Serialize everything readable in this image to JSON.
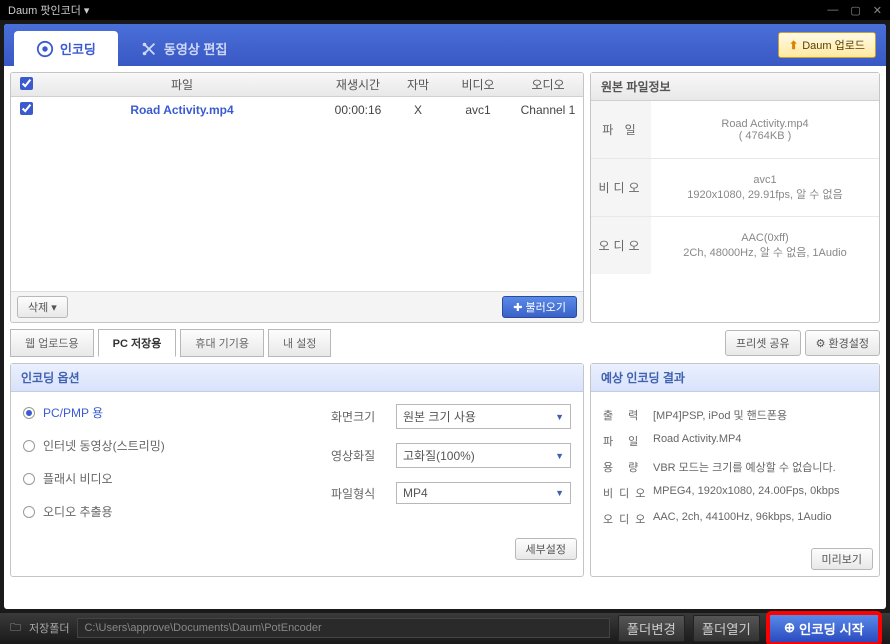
{
  "window": {
    "title": "Daum 팟인코더 ▾"
  },
  "tabs": {
    "encoding": "인코딩",
    "video_edit": "동영상 편집"
  },
  "upload_button": "Daum 업로드",
  "file_table": {
    "headers": {
      "file": "파일",
      "playtime": "재생시간",
      "subtitle": "자막",
      "video": "비디오",
      "audio": "오디오"
    },
    "rows": [
      {
        "name": "Road Activity.mp4",
        "time": "00:00:16",
        "sub": "X",
        "video": "avc1",
        "audio": "Channel 1"
      }
    ],
    "delete": "삭제",
    "load": "불러오기"
  },
  "source_info": {
    "title": "원본 파일정보",
    "file_label": "파 일",
    "file_name": "Road Activity.mp4",
    "file_size": "( 4764KB )",
    "video_label": "비디오",
    "video_codec": "avc1",
    "video_detail": "1920x1080, 29.91fps, 알 수 없음",
    "audio_label": "오디오",
    "audio_codec": "AAC(0xff)",
    "audio_detail": "2Ch, 48000Hz, 알 수 없음, 1Audio"
  },
  "preset_tabs": {
    "web": "웹 업로드용",
    "pc": "PC 저장용",
    "mobile": "휴대 기기용",
    "my": "내 설정"
  },
  "preset_share": "프리셋 공유",
  "env_settings": "환경설정",
  "encoding_options": {
    "title": "인코딩 옵션",
    "radios": {
      "pcpmp": "PC/PMP 용",
      "internet": "인터넷 동영상(스트리밍)",
      "flash": "플래시 비디오",
      "audio": "오디오 추출용"
    },
    "screen_size_label": "화면크기",
    "screen_size_value": "원본 크기 사용",
    "quality_label": "영상화질",
    "quality_value": "고화질(100%)",
    "format_label": "파일형식",
    "format_value": "MP4",
    "detail": "세부설정"
  },
  "result": {
    "title": "예상 인코딩 결과",
    "output_label": "출 력",
    "output_value": "[MP4]PSP, iPod 및 핸드폰용",
    "file_label": "파 일",
    "file_value": "Road Activity.MP4",
    "size_label": "용 량",
    "size_value": "VBR 모드는 크기를 예상할 수 없습니다.",
    "video_label": "비디오",
    "video_value": "MPEG4, 1920x1080, 24.00Fps, 0kbps",
    "audio_label": "오디오",
    "audio_value": "AAC, 2ch, 44100Hz, 96kbps, 1Audio",
    "preview": "미리보기"
  },
  "bottom": {
    "folder_label": "저장폴더",
    "path": "C:\\Users\\approve\\Documents\\Daum\\PotEncoder",
    "change": "폴더변경",
    "open": "폴더열기",
    "start": "인코딩 시작"
  }
}
